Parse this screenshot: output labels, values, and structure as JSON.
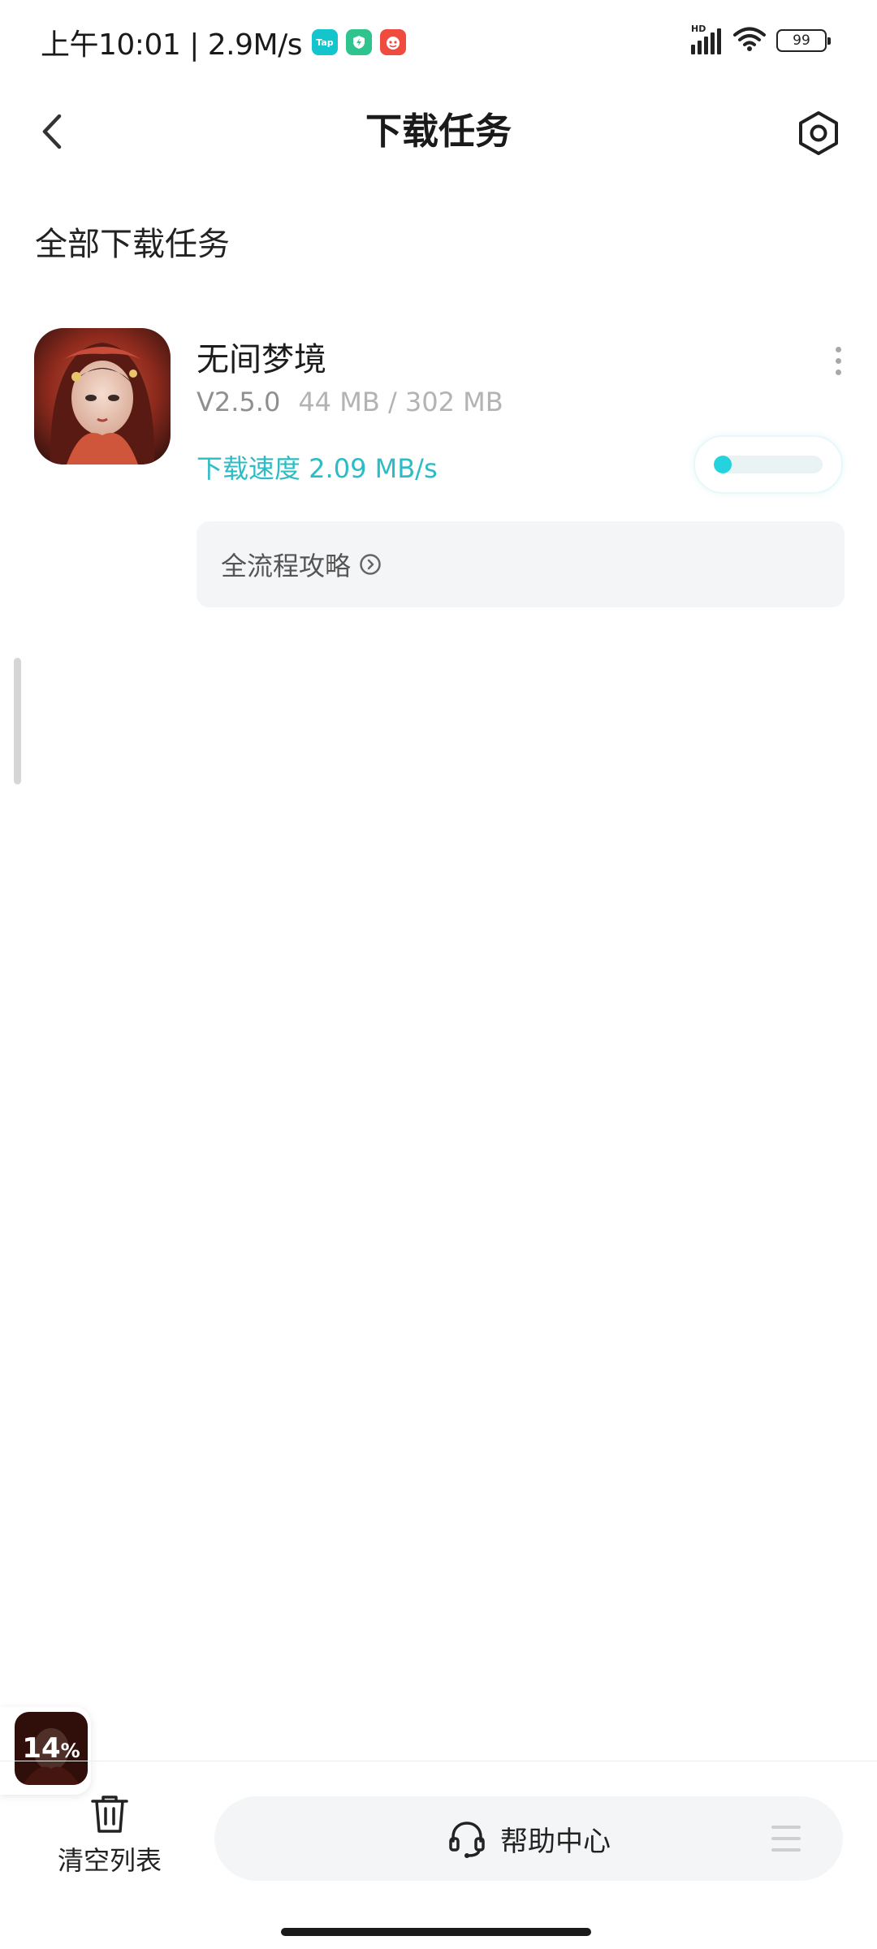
{
  "status_bar": {
    "time_and_speed": "上午10:01 | 2.9M/s",
    "tap_badge": "Tap",
    "network_label": "HD",
    "battery": "99",
    "icons": [
      "tap-app-icon",
      "shield-app-icon",
      "red-app-icon",
      "signal-icon",
      "wifi-icon",
      "battery-icon"
    ]
  },
  "header": {
    "title": "下载任务",
    "back_icon": "chevron-left-icon",
    "settings_icon": "hexagon-gear-icon"
  },
  "section": {
    "title": "全部下载任务"
  },
  "download_task": {
    "app_name": "无间梦境",
    "version": "V2.5.0",
    "size": "44 MB / 302 MB",
    "speed": "下载速度 2.09 MB/s",
    "progress": 0.146,
    "guide_label": "全流程攻略",
    "more_icon": "more-vertical-icon"
  },
  "floating": {
    "percent": "14",
    "percent_sign": "%"
  },
  "bottom_bar": {
    "clear_label": "清空列表",
    "help_label": "帮助中心",
    "clear_icon": "trash-icon",
    "help_icon": "headset-icon",
    "menu_icon": "menu-icon"
  },
  "colors": {
    "accent": "#2bbcc5",
    "progress_fill": "#24d3de",
    "muted_text": "#8f8f8f"
  }
}
